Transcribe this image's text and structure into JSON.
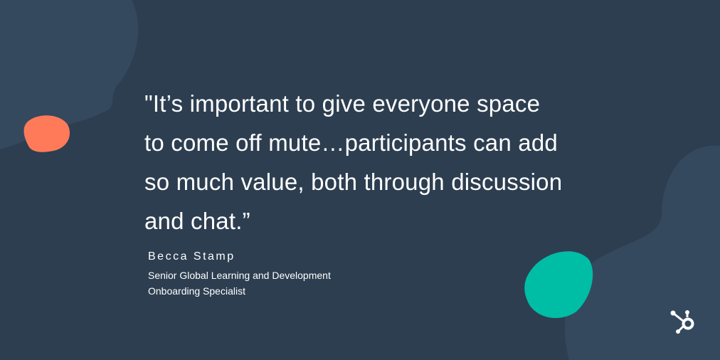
{
  "quote": {
    "lines": [
      "\"It’s important to give everyone space",
      "to come off mute…participants can add",
      "so much value, both through discussion",
      "and chat.”"
    ]
  },
  "attribution": {
    "name": "Becca Stamp",
    "title_lines": [
      "Senior Global Learning and Development",
      "Onboarding Specialist"
    ]
  },
  "logo": {
    "icon": "hubspot-sprocket-icon"
  },
  "colors": {
    "background": "#2d3e50",
    "blob": "#34495e",
    "orange": "#ff7a59",
    "teal": "#00bda5"
  }
}
